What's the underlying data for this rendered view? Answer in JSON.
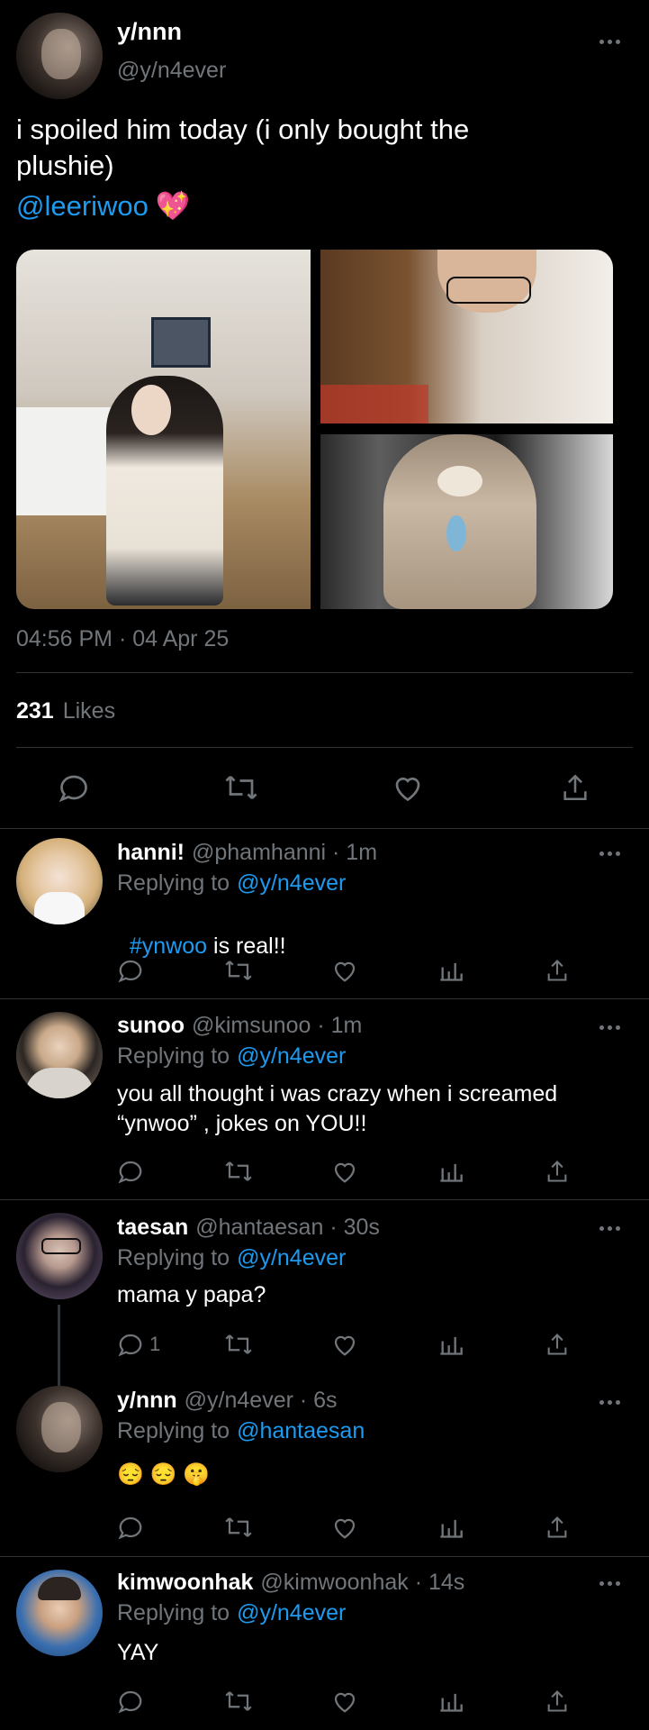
{
  "main_tweet": {
    "display_name": "y/nnn",
    "handle": "@y/n4ever",
    "text_line1": "i spoiled him today (i only bought the",
    "text_line2": "plushie)",
    "mention": "@leeriwoo",
    "emoji": "💖",
    "timestamp": "04:56 PM · 04 Apr 25",
    "likes_count": "231",
    "likes_label": "Likes",
    "photos": [
      "cafe-girl-photo",
      "boy-with-glasses-photo",
      "otter-plushie-photo"
    ]
  },
  "replies": [
    {
      "display_name": "hanni!",
      "meta": "@phamhanni · 1m",
      "replying_label": "Replying to",
      "replying_to": "@y/n4ever",
      "hashtag": "#ynwoo",
      "text": " is real!!",
      "reply_count": ""
    },
    {
      "display_name": "sunoo",
      "meta": "@kimsunoo · 1m",
      "replying_label": "Replying to",
      "replying_to": "@y/n4ever",
      "text_line1": "you all thought i was crazy when i screamed",
      "text_line2": "“ynwoo” , jokes on YOU!!",
      "reply_count": ""
    },
    {
      "display_name": "taesan",
      "meta": "@hantaesan · 30s",
      "replying_label": "Replying to",
      "replying_to": "@y/n4ever",
      "text": "mama y papa?",
      "reply_count": "1"
    },
    {
      "display_name": "y/nnn",
      "meta": "@y/n4ever · 6s",
      "replying_label": "Replying to",
      "replying_to": "@hantaesan",
      "text": "😔 😔 🤫",
      "reply_count": ""
    },
    {
      "display_name": "kimwoonhak",
      "meta": "@kimwoonhak · 14s",
      "replying_label": "Replying to",
      "replying_to": "@y/n4ever",
      "text": "YAY",
      "reply_count": ""
    }
  ],
  "colors": {
    "background": "#000000",
    "accent": "#1d9bf0",
    "muted": "#71767b",
    "divider": "#2f3336"
  }
}
